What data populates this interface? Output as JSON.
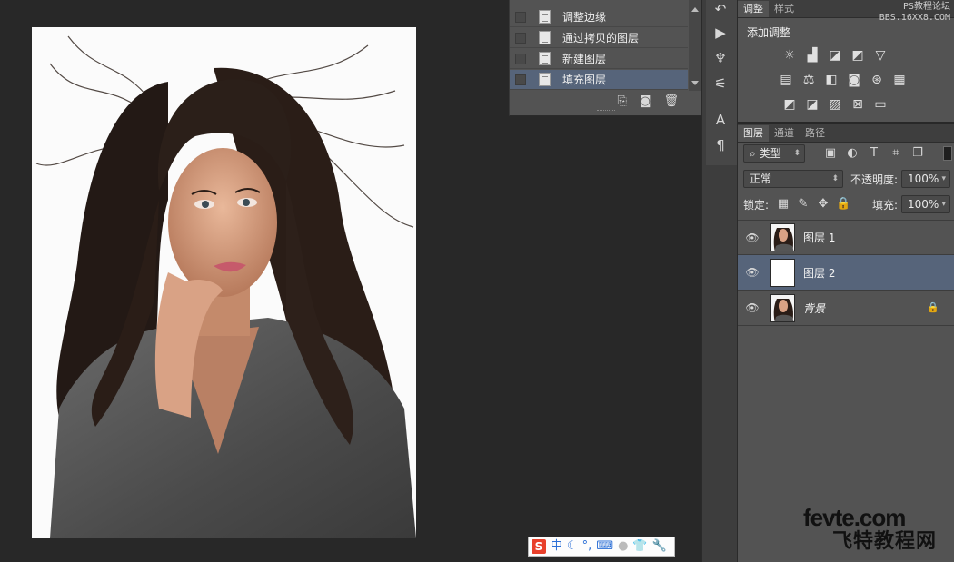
{
  "history": {
    "items": [
      {
        "label": "调整边缘",
        "selected": false
      },
      {
        "label": "通过拷贝的图层",
        "selected": false
      },
      {
        "label": "新建图层",
        "selected": false
      },
      {
        "label": "填充图层",
        "selected": true
      }
    ],
    "footer_icons": [
      "new-document-from-state-icon",
      "camera-snapshot-icon",
      "trash-icon"
    ]
  },
  "adjustments": {
    "tabs": [
      "调整",
      "样式"
    ],
    "title": "添加调整",
    "watermark_line1": "PS教程论坛",
    "watermark_line2": "BBS.16XX8.COM",
    "icon_rows": [
      [
        "brightness-icon",
        "levels-icon",
        "curves-icon",
        "exposure-icon",
        "gradient-triangle-icon"
      ],
      [
        "vibrance-icon",
        "color-balance-icon",
        "black-white-icon",
        "photo-filter-icon",
        "channel-mixer-icon",
        "color-lookup-icon"
      ],
      [
        "invert-icon",
        "posterize-icon",
        "threshold-icon",
        "selective-color-icon",
        "gradient-map-icon"
      ]
    ]
  },
  "layers_panel": {
    "tabs": [
      "图层",
      "通道",
      "路径"
    ],
    "filter_label": "类型",
    "blend_mode": "正常",
    "opacity_label": "不透明度:",
    "opacity_value": "100%",
    "lock_label": "锁定:",
    "fill_label": "填充:",
    "fill_value": "100%",
    "layers": [
      {
        "name": "图层 1",
        "selected": false,
        "thumb": "portrait",
        "italic": false,
        "locked": false
      },
      {
        "name": "图层 2",
        "selected": true,
        "thumb": "white",
        "italic": false,
        "locked": false
      },
      {
        "name": "背景",
        "selected": false,
        "thumb": "portrait",
        "italic": true,
        "locked": true
      }
    ]
  },
  "ime_bar": {
    "logo": "S",
    "mode": "中"
  },
  "site_logo": {
    "top": "fevte.com",
    "bottom": "飞特教程网"
  }
}
